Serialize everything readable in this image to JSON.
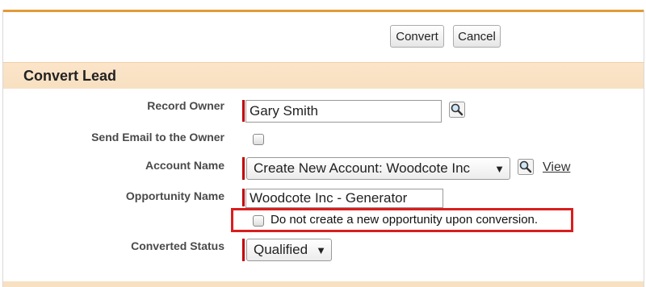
{
  "toolbar": {
    "convert_label": "Convert",
    "cancel_label": "Cancel"
  },
  "section": {
    "title": "Convert Lead"
  },
  "form": {
    "record_owner": {
      "label": "Record Owner",
      "value": "Gary Smith",
      "lookup_icon": "magnifier-icon"
    },
    "send_email": {
      "label": "Send Email to the Owner",
      "checked": false
    },
    "account_name": {
      "label": "Account Name",
      "selected": "Create New Account: Woodcote Inc",
      "lookup_icon": "magnifier-icon",
      "view_label": "View"
    },
    "opportunity_name": {
      "label": "Opportunity Name",
      "value": "Woodcote Inc - Generator",
      "no_opportunity_label": "Do not create a new opportunity upon conversion.",
      "no_opportunity_checked": false
    },
    "converted_status": {
      "label": "Converted Status",
      "selected": "Qualified"
    }
  },
  "colors": {
    "accent_bar": "#e29a3a",
    "section_bg": "#f8e0c2",
    "required_marker": "#c00000",
    "highlight_border": "#d91e1e"
  }
}
